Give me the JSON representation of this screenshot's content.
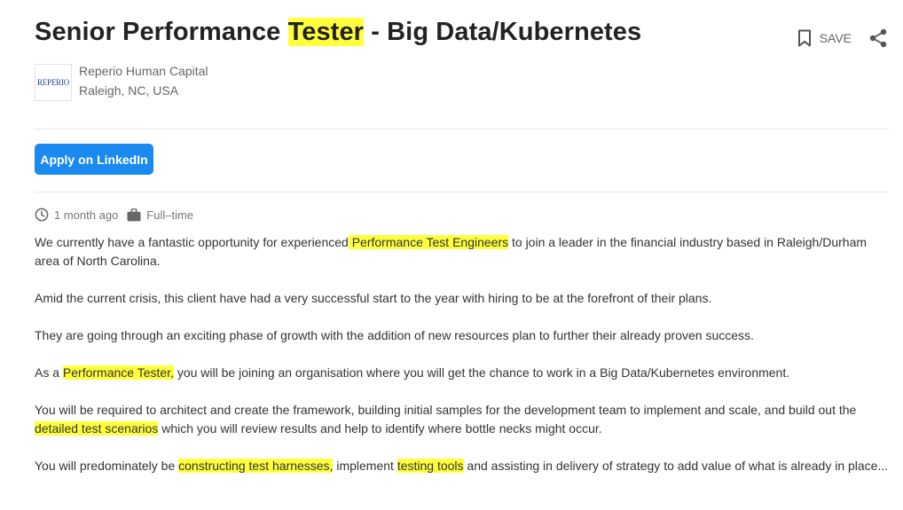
{
  "job": {
    "title_part1": "Senior Performance ",
    "title_highlight": "Tester",
    "title_part2": " - Big Data/Kubernetes",
    "save_label": "SAVE",
    "company_name": "Reperio Human Capital",
    "logo_text": "REPERIO",
    "location": "Raleigh, NC, USA",
    "apply_label": "Apply on LinkedIn",
    "posted": "1 month ago",
    "job_type": "Full–time"
  },
  "description": {
    "p1_a": "We currently have a fantastic opportunity for experienced",
    "p1_hl": " Performance Test Engineers",
    "p1_b": " to join a leader in the financial industry based in Raleigh/Durham area of North Carolina.",
    "p2": "Amid the current crisis, this client have had a very successful start to the year with hiring to be at the forefront of their plans.",
    "p3": "They are going through an exciting phase of growth with the addition of new resources plan to further their already proven success.",
    "p4_a": "As a ",
    "p4_hl": "Performance Tester,",
    "p4_b": " you will be joining an organisation where you will get the chance to work in a Big Data/Kubernetes environment.",
    "p5_a": "You will be required to architect and create the framework, building initial samples for the development team to implement and scale, and build out the ",
    "p5_hl": "detailed test scenarios",
    "p5_b": " which you will review results and help to identify where bottle necks might occur.",
    "p6_a": "You will predominately be ",
    "p6_hl1": "constructing test harnesses,",
    "p6_b": " implement ",
    "p6_hl2": "testing tools",
    "p6_c": " and assisting in delivery of strategy to add value of what is already in place..."
  },
  "colors": {
    "highlight": "#ffff3d",
    "apply_button": "#1a8af0",
    "muted_text": "#666666"
  },
  "icons": [
    "bookmark-icon",
    "share-icon",
    "clock-icon",
    "briefcase-icon"
  ]
}
